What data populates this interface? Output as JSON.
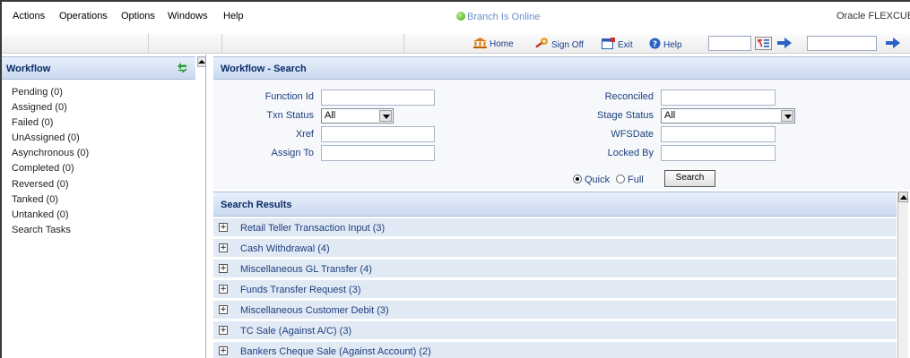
{
  "menu": [
    "Actions",
    "Operations",
    "Options",
    "Windows",
    "Help"
  ],
  "status_text": "Branch Is Online",
  "brand": "Oracle FLEXCUBE",
  "toolbar": {
    "home": "Home",
    "sign_off": "Sign Off",
    "exit": "Exit",
    "help": "Help"
  },
  "workflow": {
    "title": "Workflow",
    "items": [
      "Pending  (0)",
      "Assigned  (0)",
      "Failed  (0)",
      "UnAssigned  (0)",
      "Asynchronous  (0)",
      "Completed  (0)",
      "Reversed  (0)",
      "Tanked  (0)",
      "Untanked  (0)",
      "Search Tasks"
    ]
  },
  "search": {
    "title": "Workflow - Search",
    "function_id_label": "Function Id",
    "txn_status_label": "Txn Status",
    "txn_status_value": "All",
    "xref_label": "Xref",
    "assign_to_label": "Assign To",
    "reconciled_label": "Reconciled",
    "stage_status_label": "Stage Status",
    "stage_status_value": "All",
    "wfsdate_label": "WFSDate",
    "locked_by_label": "Locked By",
    "quick_label": "Quick",
    "full_label": "Full",
    "search_button": "Search"
  },
  "results": {
    "title": "Search Results",
    "rows": [
      "Retail Teller Transaction Input (3)",
      "Cash Withdrawal (4)",
      "Miscellaneous GL Transfer (4)",
      "Funds Transfer Request (3)",
      "Miscellaneous Customer Debit (3)",
      "TC Sale (Against A/C) (3)",
      "Bankers Cheque Sale (Against Account) (2)"
    ]
  }
}
